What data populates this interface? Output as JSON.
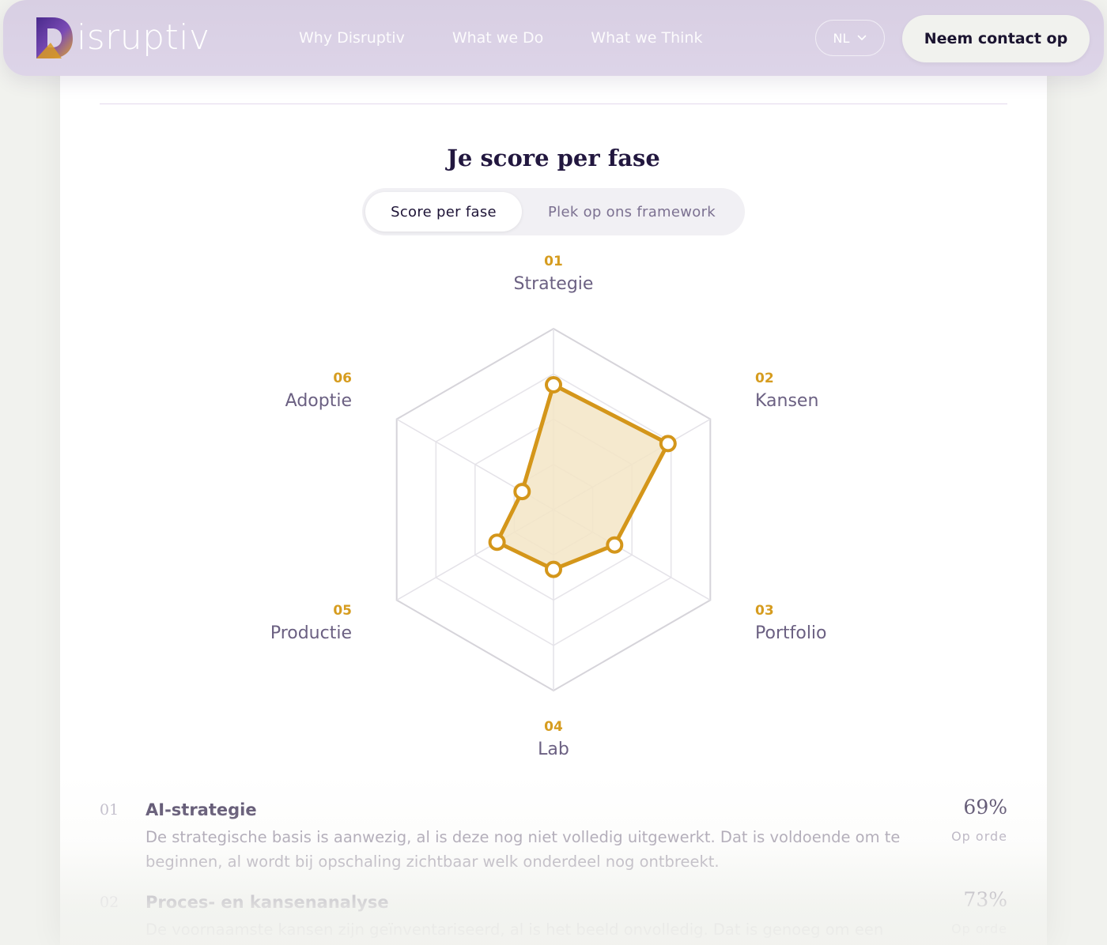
{
  "brand": {
    "name": "isruptiv",
    "logo_letter": "D"
  },
  "nav": {
    "links": [
      "Why Disruptiv",
      "What we Do",
      "What we Think"
    ],
    "language": "NL",
    "cta": "Neem contact op"
  },
  "section": {
    "title": "Je score per fase",
    "toggle": {
      "active": "Score per fase",
      "inactive": "Plek op ons framework"
    }
  },
  "chart_data": {
    "type": "radar",
    "rings": 4,
    "range": [
      0,
      100
    ],
    "axes": [
      {
        "num": "01",
        "label": "Strategie",
        "value": 69
      },
      {
        "num": "02",
        "label": "Kansen",
        "value": 73
      },
      {
        "num": "03",
        "label": "Portfolio",
        "value": 39
      },
      {
        "num": "04",
        "label": "Lab",
        "value": 33
      },
      {
        "num": "05",
        "label": "Productie",
        "value": 36
      },
      {
        "num": "06",
        "label": "Adoptie",
        "value": 20
      }
    ],
    "colors": {
      "stroke": "#d4961a",
      "fill": "#f3e5c6",
      "grid": "#d8d6dc"
    }
  },
  "list": [
    {
      "num": "01",
      "title": "AI-strategie",
      "desc": "De strategische basis is aanwezig, al is deze nog niet volledig uitgewerkt. Dat is voldoende om te beginnen, al wordt bij opschaling zichtbaar welk onderdeel nog ontbreekt.",
      "pct": "69%",
      "status": "Op orde"
    },
    {
      "num": "02",
      "title": "Proces- en kansenanalyse",
      "desc": "De voornaamste kansen zijn geïnventariseerd, al is het beeld onvolledig. Dat is genoeg om een",
      "pct": "73%",
      "status": "Op orde"
    }
  ]
}
